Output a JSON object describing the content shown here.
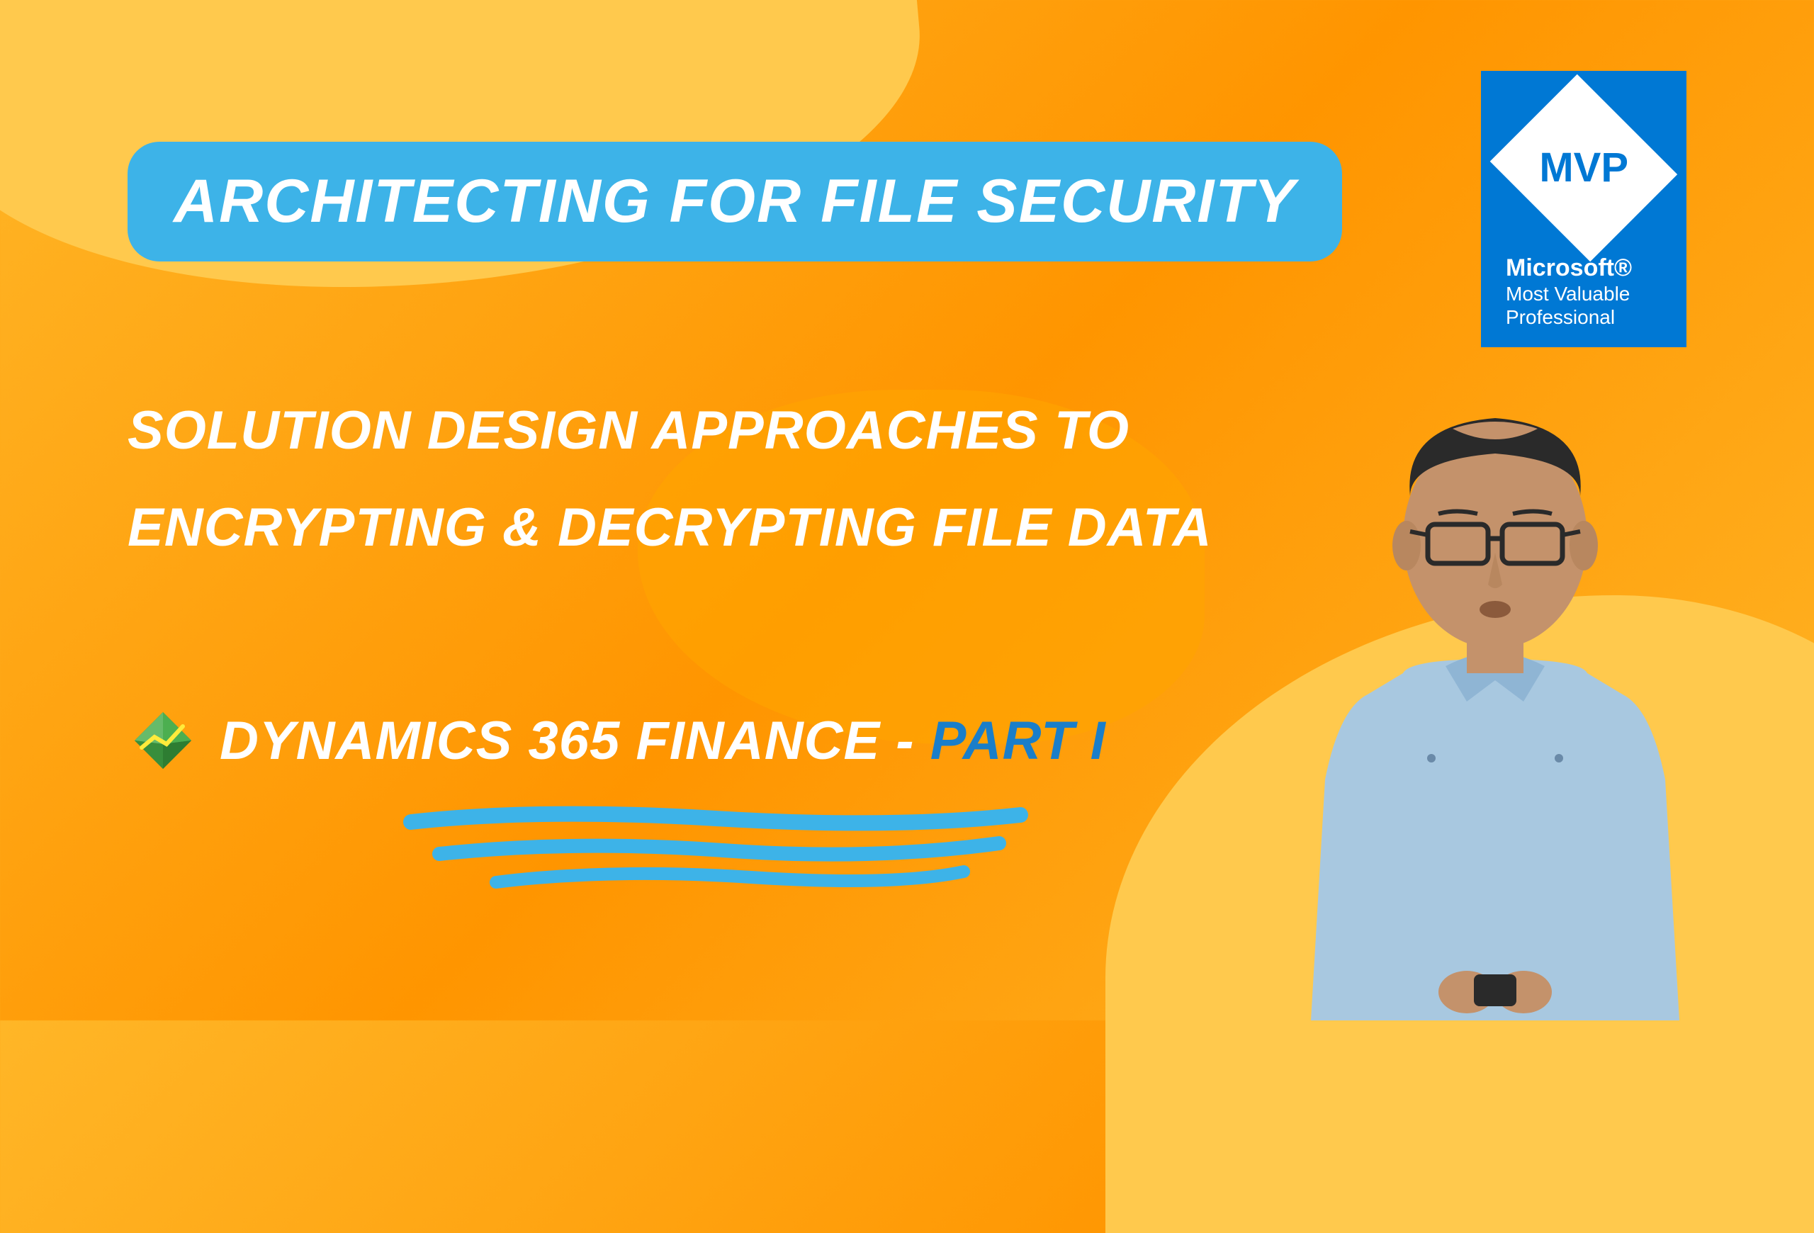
{
  "title": "Architecting for File Security",
  "subtitle": {
    "line1": "Solution Design Approaches to",
    "line2": "Encrypting & Decrypting File Data"
  },
  "product": {
    "name": "Dynamics 365 Finance - ",
    "part": "Part I"
  },
  "badge": {
    "abbr": "MVP",
    "brand": "Microsoft®",
    "desc1": "Most Valuable",
    "desc2": "Professional"
  }
}
